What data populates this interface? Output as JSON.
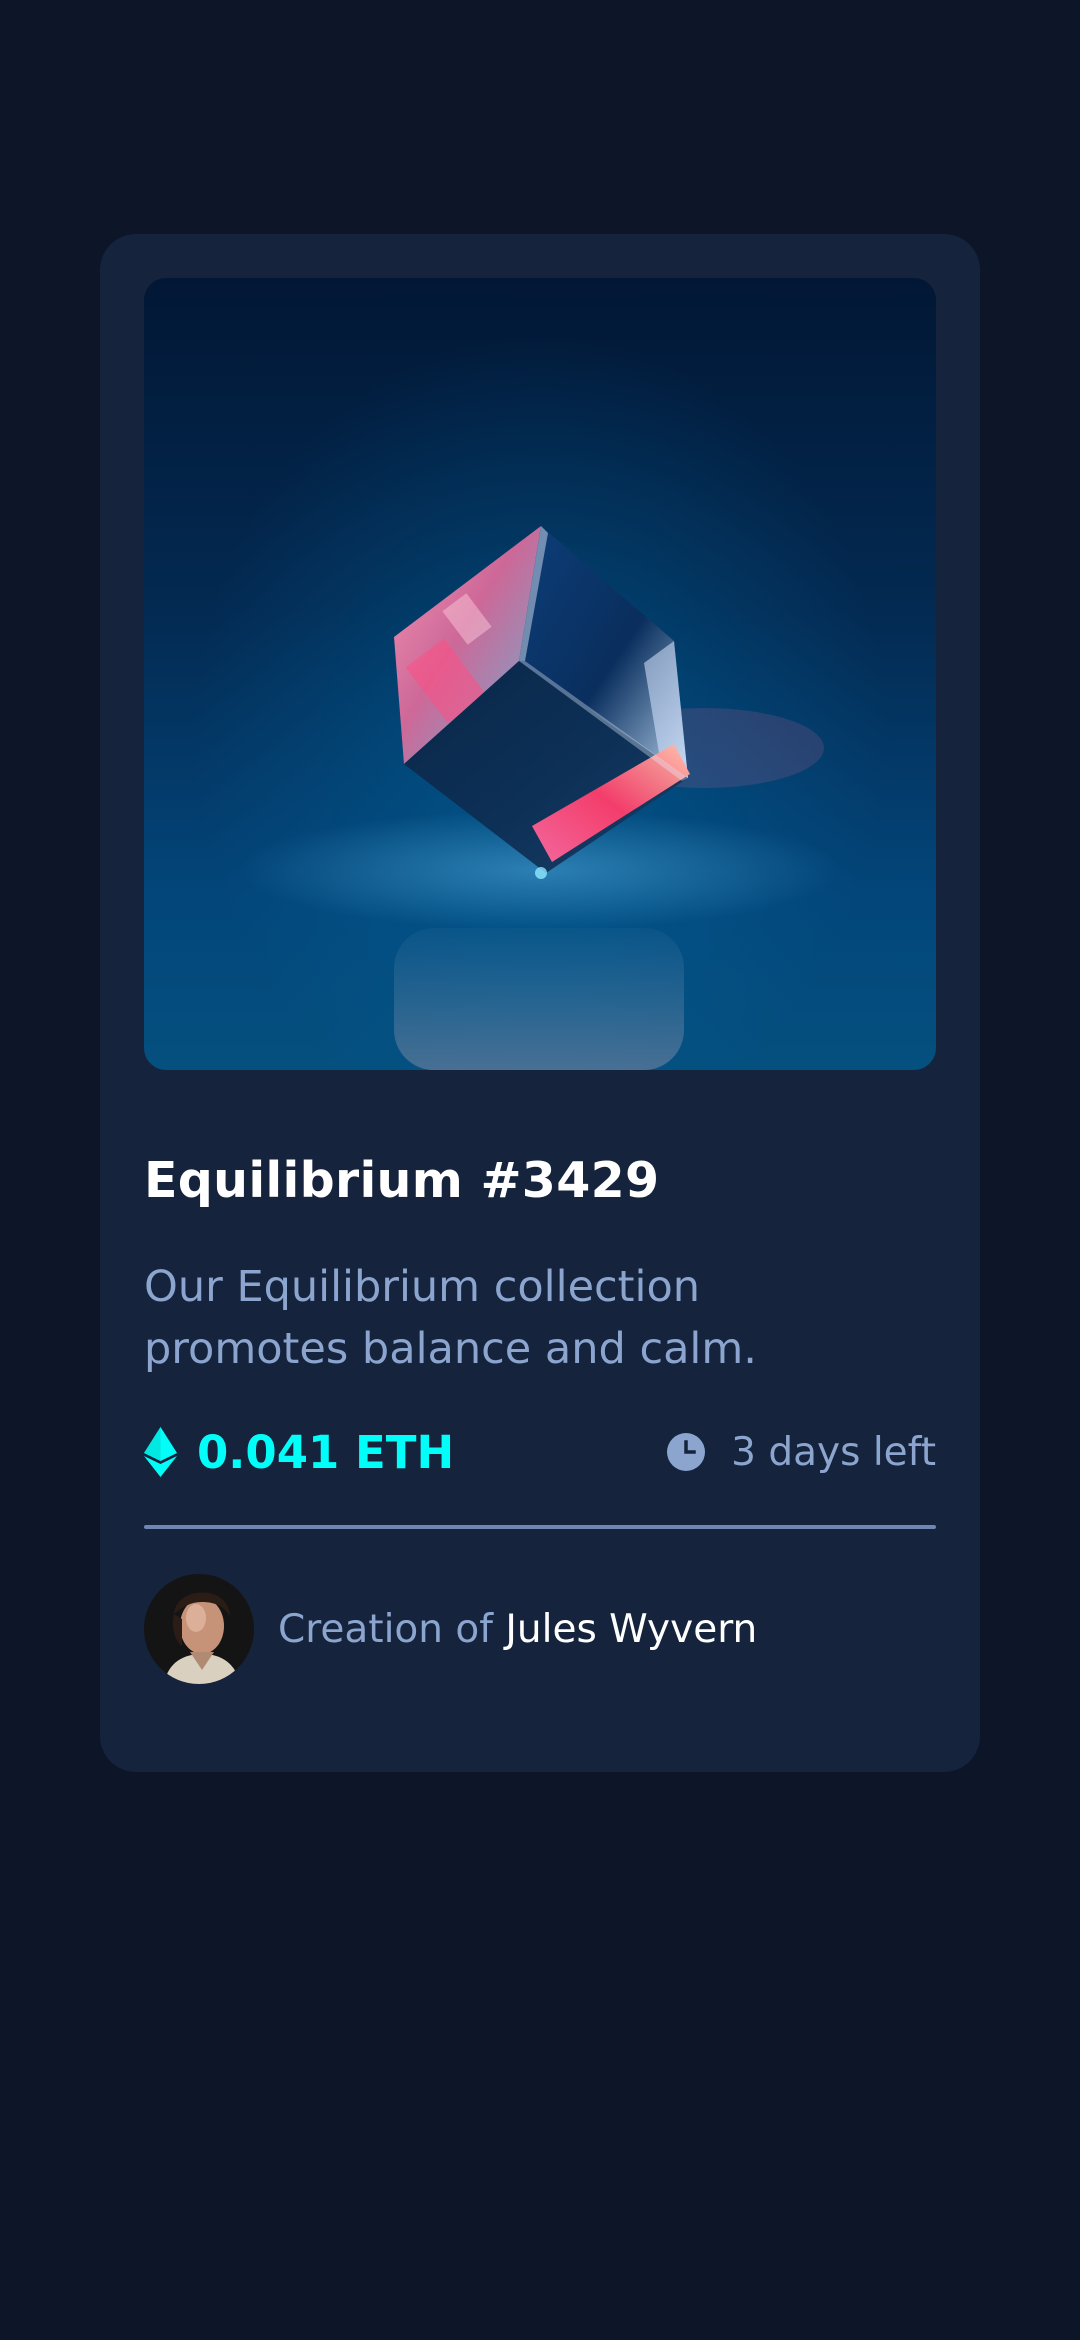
{
  "card": {
    "image_alt": "Equilibrium",
    "title": "Equilibrium #3429",
    "description": "Our Equilibrium collection promotes balance and calm.",
    "price": {
      "icon": "ethereum-icon",
      "label": "0.041 ETH"
    },
    "time_left": {
      "icon": "clock-icon",
      "label": "3 days left"
    },
    "creator": {
      "avatar_alt": "Jules Wyvern",
      "prefix": "Creation of",
      "name": "Jules Wyvern"
    }
  },
  "colors": {
    "page_background": "#0d1628",
    "card_background": "#15233c",
    "accent_cyan": "#00fff8",
    "soft_blue": "#8ba5cf",
    "divider": "#6f85b4",
    "white": "#ffffff"
  }
}
